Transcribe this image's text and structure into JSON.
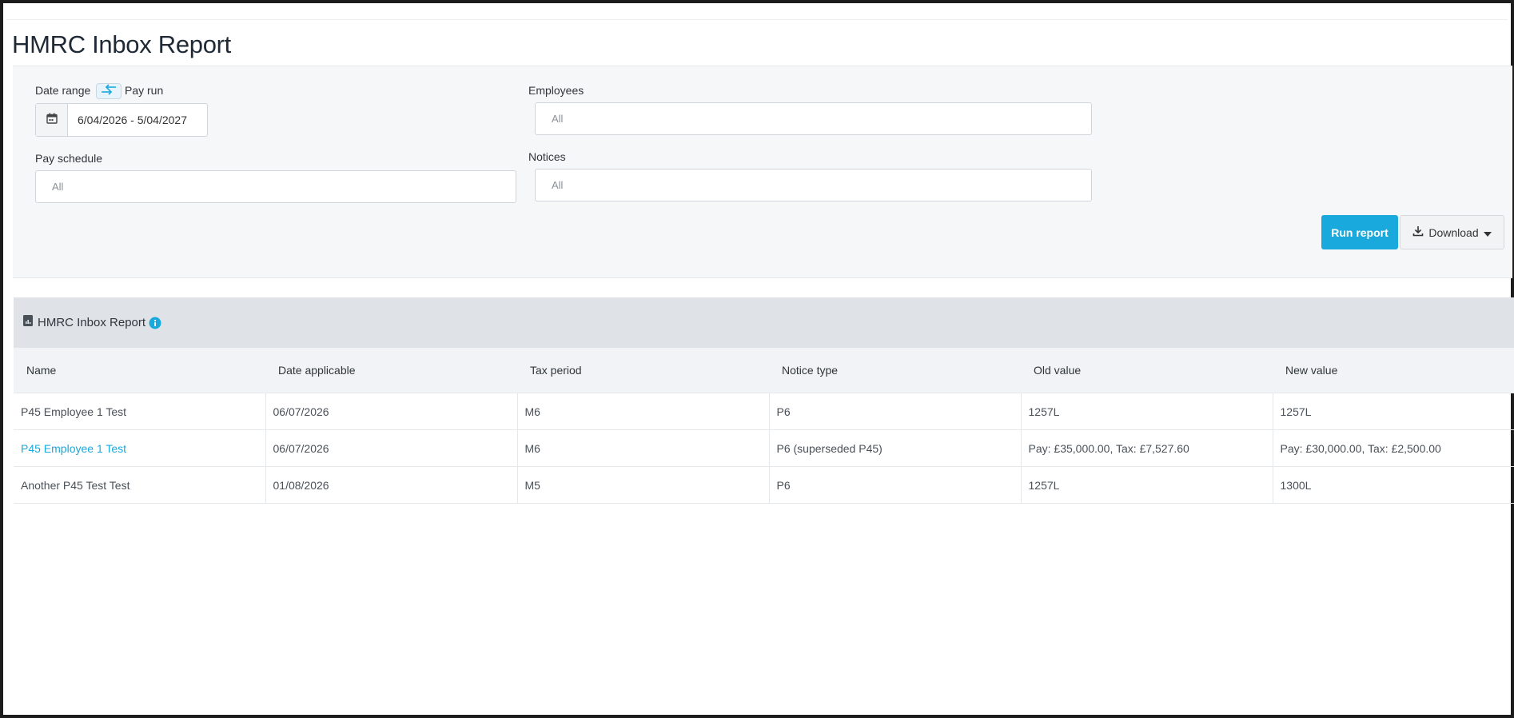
{
  "page": {
    "title": "HMRC Inbox Report"
  },
  "filters": {
    "date_range_label": "Date range",
    "pay_run_label": "Pay run",
    "date_range_value": "6/04/2026 - 5/04/2027",
    "employees_label": "Employees",
    "employees_value": "All",
    "pay_schedule_label": "Pay schedule",
    "pay_schedule_value": "All",
    "notices_label": "Notices",
    "notices_value": "All"
  },
  "actions": {
    "run_label": "Run report",
    "download_label": "Download"
  },
  "report": {
    "title": "HMRC Inbox Report",
    "columns": [
      "Name",
      "Date applicable",
      "Tax period",
      "Notice type",
      "Old value",
      "New value"
    ],
    "rows": [
      {
        "name": "P45 Employee 1 Test",
        "date": "06/07/2026",
        "period": "M6",
        "type": "P6",
        "old": "1257L",
        "new": "1257L"
      },
      {
        "name": "P45 Employee 1 Test",
        "date": "06/07/2026",
        "period": "M6",
        "type": "P6 (superseded P45)",
        "old": "Pay: £35,000.00, Tax: £7,527.60",
        "new": "Pay: £30,000.00, Tax: £2,500.00"
      },
      {
        "name": "Another P45 Test Test",
        "date": "01/08/2026",
        "period": "M5",
        "type": "P6",
        "old": "1257L",
        "new": "1300L"
      }
    ]
  },
  "colors": {
    "accent": "#1aa9dc",
    "header_bg": "#dfe3e7",
    "filter_bg": "#f6f7f9"
  }
}
